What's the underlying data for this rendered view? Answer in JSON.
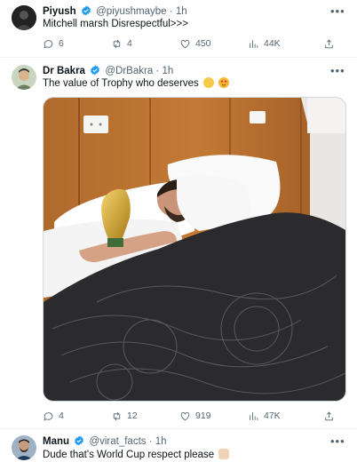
{
  "tweets": [
    {
      "name": "Piyush",
      "handle": "@piyushmaybe",
      "dot": "·",
      "time": "1h",
      "text": "Mitchell marsh Disrespectful>>>",
      "stats": {
        "replies": "6",
        "reposts": "4",
        "likes": "450",
        "views": "44K"
      }
    },
    {
      "name": "Dr Bakra",
      "handle": "@DrBakra",
      "dot": "·",
      "time": "1h",
      "text": "The value of Trophy who deserves",
      "text_emojis": [
        "clapping-hands-emoji",
        "heart-eyes-emoji"
      ],
      "stats": {
        "replies": "4",
        "reposts": "12",
        "likes": "919",
        "views": "47K"
      }
    },
    {
      "name": "Manu",
      "handle": "@virat_facts",
      "dot": "·",
      "time": "1h",
      "text": "Dude that's World Cup respect please"
    }
  ],
  "colors": {
    "verified": "#1d9bf0",
    "muted": "#536471",
    "text": "#0f1419",
    "divider": "#eff3f4"
  }
}
